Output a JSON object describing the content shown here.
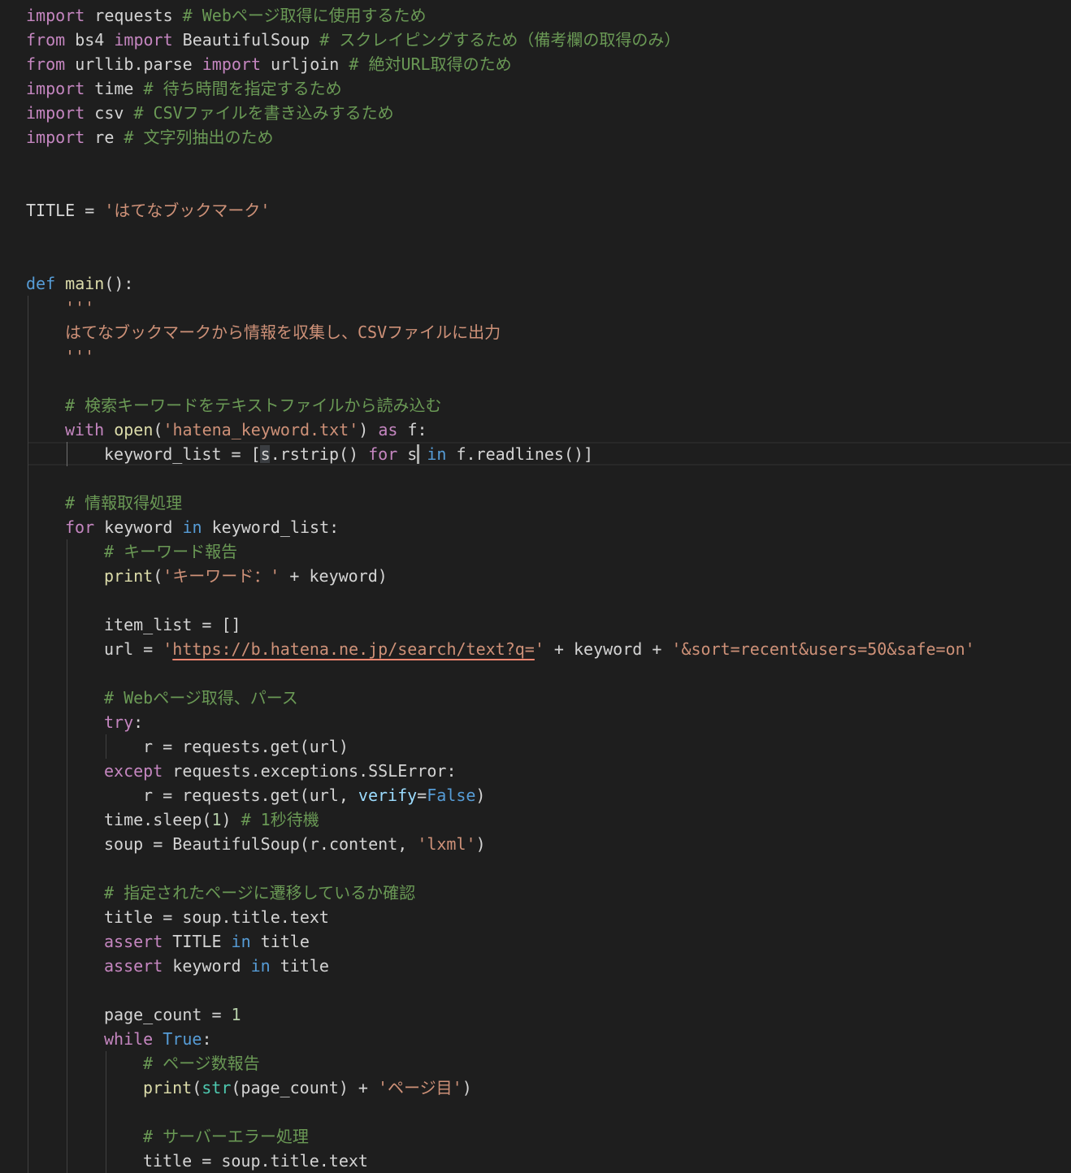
{
  "theme": {
    "background": "#1e1e1e",
    "colors": {
      "plain": "#d4d4d4",
      "keyword": "#c586c0",
      "storage": "#569cd6",
      "function": "#dcdcaa",
      "string": "#ce9178",
      "comment": "#6a9955",
      "number": "#b5cea8",
      "builtin": "#4ec9b0",
      "param": "#9cdcfe"
    }
  },
  "editor": {
    "lines": [
      {
        "indent": 0,
        "tokens": [
          [
            "keyword",
            "import"
          ],
          [
            "plain",
            " requests "
          ],
          [
            "comment",
            "# Webページ取得に使用するため"
          ]
        ]
      },
      {
        "indent": 0,
        "tokens": [
          [
            "keyword",
            "from"
          ],
          [
            "plain",
            " bs4 "
          ],
          [
            "keyword",
            "import"
          ],
          [
            "plain",
            " BeautifulSoup "
          ],
          [
            "comment",
            "# スクレイピングするため（備考欄の取得のみ）"
          ]
        ]
      },
      {
        "indent": 0,
        "tokens": [
          [
            "keyword",
            "from"
          ],
          [
            "plain",
            " urllib.parse "
          ],
          [
            "keyword",
            "import"
          ],
          [
            "plain",
            " urljoin "
          ],
          [
            "comment",
            "# 絶対URL取得のため"
          ]
        ]
      },
      {
        "indent": 0,
        "tokens": [
          [
            "keyword",
            "import"
          ],
          [
            "plain",
            " time "
          ],
          [
            "comment",
            "# 待ち時間を指定するため"
          ]
        ]
      },
      {
        "indent": 0,
        "tokens": [
          [
            "keyword",
            "import"
          ],
          [
            "plain",
            " csv "
          ],
          [
            "comment",
            "# CSVファイルを書き込みするため"
          ]
        ]
      },
      {
        "indent": 0,
        "tokens": [
          [
            "keyword",
            "import"
          ],
          [
            "plain",
            " re "
          ],
          [
            "comment",
            "# 文字列抽出のため"
          ]
        ]
      },
      {
        "indent": 0,
        "tokens": []
      },
      {
        "indent": 0,
        "tokens": []
      },
      {
        "indent": 0,
        "tokens": [
          [
            "plain",
            "TITLE = "
          ],
          [
            "string",
            "'はてなブックマーク'"
          ]
        ]
      },
      {
        "indent": 0,
        "tokens": []
      },
      {
        "indent": 0,
        "tokens": []
      },
      {
        "indent": 0,
        "tokens": [
          [
            "storage",
            "def"
          ],
          [
            "plain",
            " "
          ],
          [
            "function",
            "main"
          ],
          [
            "plain",
            "():"
          ]
        ]
      },
      {
        "indent": 1,
        "tokens": [
          [
            "string",
            "'''"
          ]
        ]
      },
      {
        "indent": 1,
        "tokens": [
          [
            "string",
            "はてなブックマークから情報を収集し、CSVファイルに出力"
          ]
        ]
      },
      {
        "indent": 1,
        "tokens": [
          [
            "string",
            "'''"
          ]
        ]
      },
      {
        "indent": 0,
        "tokens": []
      },
      {
        "indent": 1,
        "tokens": [
          [
            "comment",
            "# 検索キーワードをテキストファイルから読み込む"
          ]
        ]
      },
      {
        "indent": 1,
        "tokens": [
          [
            "keyword",
            "with"
          ],
          [
            "plain",
            " "
          ],
          [
            "function",
            "open"
          ],
          [
            "plain",
            "("
          ],
          [
            "string",
            "'hatena_keyword.txt'"
          ],
          [
            "plain",
            ") "
          ],
          [
            "keyword",
            "as"
          ],
          [
            "plain",
            " f:"
          ]
        ]
      },
      {
        "indent": 2,
        "tokens": [
          [
            "plain",
            "keyword_list = [s.rstrip() "
          ],
          [
            "keyword",
            "for"
          ],
          [
            "plain",
            " s "
          ],
          [
            "storage",
            "in"
          ],
          [
            "plain",
            " f.readlines()]"
          ]
        ]
      },
      {
        "indent": 0,
        "tokens": []
      },
      {
        "indent": 1,
        "tokens": [
          [
            "comment",
            "# 情報取得処理"
          ]
        ]
      },
      {
        "indent": 1,
        "tokens": [
          [
            "keyword",
            "for"
          ],
          [
            "plain",
            " keyword "
          ],
          [
            "storage",
            "in"
          ],
          [
            "plain",
            " keyword_list:"
          ]
        ]
      },
      {
        "indent": 2,
        "tokens": [
          [
            "comment",
            "# キーワード報告"
          ]
        ]
      },
      {
        "indent": 2,
        "tokens": [
          [
            "function",
            "print"
          ],
          [
            "plain",
            "("
          ],
          [
            "string",
            "'キーワード：'"
          ],
          [
            "plain",
            " + keyword)"
          ]
        ]
      },
      {
        "indent": 0,
        "tokens": []
      },
      {
        "indent": 2,
        "tokens": [
          [
            "plain",
            "item_list = []"
          ]
        ]
      },
      {
        "indent": 2,
        "tokens": [
          [
            "plain",
            "url = "
          ],
          [
            "string",
            "'"
          ],
          [
            "string-underline",
            "https://b.hatena.ne.jp/search/text?q="
          ],
          [
            "string",
            "'"
          ],
          [
            "plain",
            " + keyword + "
          ],
          [
            "string",
            "'&sort=recent&users=50&safe=on'"
          ]
        ]
      },
      {
        "indent": 0,
        "tokens": []
      },
      {
        "indent": 2,
        "tokens": [
          [
            "comment",
            "# Webページ取得、パース"
          ]
        ]
      },
      {
        "indent": 2,
        "tokens": [
          [
            "keyword",
            "try"
          ],
          [
            "plain",
            ":"
          ]
        ]
      },
      {
        "indent": 3,
        "tokens": [
          [
            "plain",
            "r = requests.get(url)"
          ]
        ]
      },
      {
        "indent": 2,
        "tokens": [
          [
            "keyword",
            "except"
          ],
          [
            "plain",
            " requests.exceptions.SSLError:"
          ]
        ]
      },
      {
        "indent": 3,
        "tokens": [
          [
            "plain",
            "r = requests.get(url, "
          ],
          [
            "param",
            "verify"
          ],
          [
            "plain",
            "="
          ],
          [
            "storage",
            "False"
          ],
          [
            "plain",
            ")"
          ]
        ]
      },
      {
        "indent": 2,
        "tokens": [
          [
            "plain",
            "time.sleep("
          ],
          [
            "number",
            "1"
          ],
          [
            "plain",
            ") "
          ],
          [
            "comment",
            "# 1秒待機"
          ]
        ]
      },
      {
        "indent": 2,
        "tokens": [
          [
            "plain",
            "soup = BeautifulSoup(r.content, "
          ],
          [
            "string",
            "'lxml'"
          ],
          [
            "plain",
            ")"
          ]
        ]
      },
      {
        "indent": 0,
        "tokens": []
      },
      {
        "indent": 2,
        "tokens": [
          [
            "comment",
            "# 指定されたページに遷移しているか確認"
          ]
        ]
      },
      {
        "indent": 2,
        "tokens": [
          [
            "plain",
            "title = soup.title.text"
          ]
        ]
      },
      {
        "indent": 2,
        "tokens": [
          [
            "keyword",
            "assert"
          ],
          [
            "plain",
            " TITLE "
          ],
          [
            "storage",
            "in"
          ],
          [
            "plain",
            " title"
          ]
        ]
      },
      {
        "indent": 2,
        "tokens": [
          [
            "keyword",
            "assert"
          ],
          [
            "plain",
            " keyword "
          ],
          [
            "storage",
            "in"
          ],
          [
            "plain",
            " title"
          ]
        ]
      },
      {
        "indent": 0,
        "tokens": []
      },
      {
        "indent": 2,
        "tokens": [
          [
            "plain",
            "page_count = "
          ],
          [
            "number",
            "1"
          ]
        ]
      },
      {
        "indent": 2,
        "tokens": [
          [
            "keyword",
            "while"
          ],
          [
            "plain",
            " "
          ],
          [
            "storage",
            "True"
          ],
          [
            "plain",
            ":"
          ]
        ]
      },
      {
        "indent": 3,
        "tokens": [
          [
            "comment",
            "# ページ数報告"
          ]
        ]
      },
      {
        "indent": 3,
        "tokens": [
          [
            "function",
            "print"
          ],
          [
            "plain",
            "("
          ],
          [
            "builtin",
            "str"
          ],
          [
            "plain",
            "(page_count) + "
          ],
          [
            "string",
            "'ページ目'"
          ],
          [
            "plain",
            ")"
          ]
        ]
      },
      {
        "indent": 0,
        "tokens": []
      },
      {
        "indent": 3,
        "tokens": [
          [
            "comment",
            "# サーバーエラー処理"
          ]
        ]
      },
      {
        "indent": 3,
        "tokens": [
          [
            "plain",
            "title = soup.title.text"
          ]
        ]
      }
    ]
  }
}
